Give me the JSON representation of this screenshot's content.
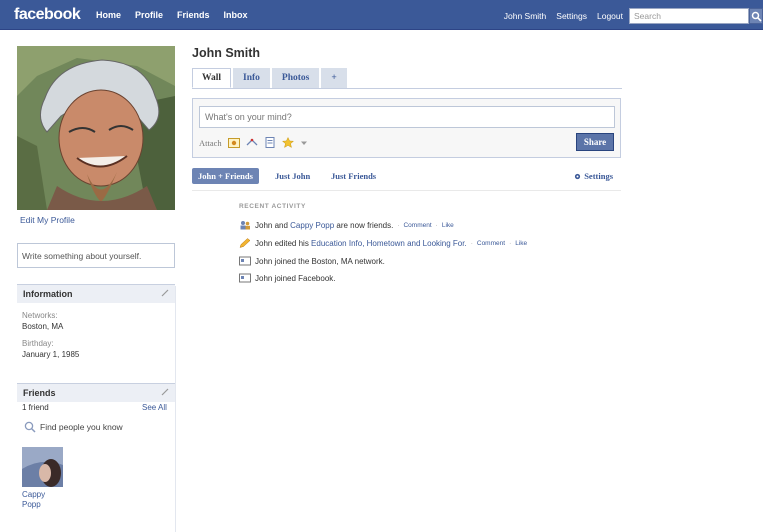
{
  "topbar": {
    "logo": "facebook",
    "nav_left": [
      "Home",
      "Profile",
      "Friends",
      "Inbox"
    ],
    "nav_right": [
      "John Smith",
      "Settings",
      "Logout"
    ],
    "search_placeholder": "Search"
  },
  "profile": {
    "name": "John Smith",
    "edit_link": "Edit My Profile",
    "about_placeholder": "Write something about yourself."
  },
  "information": {
    "title": "Information",
    "networks_label": "Networks:",
    "networks_value": "Boston, MA",
    "birthday_label": "Birthday:",
    "birthday_value": "January 1, 1985"
  },
  "friends": {
    "title": "Friends",
    "count": "1 friend",
    "see_all": "See All",
    "find_people": "Find people you know",
    "friend_name_1": "Cappy",
    "friend_name_2": "Popp"
  },
  "tabs": [
    "Wall",
    "Info",
    "Photos",
    "+"
  ],
  "publisher": {
    "placeholder": "What's on your mind?",
    "attach_label": "Attach",
    "share_label": "Share"
  },
  "filters": {
    "active": "John + Friends",
    "just_john": "Just John",
    "just_friends": "Just Friends",
    "settings": "Settings"
  },
  "recent_activity": {
    "label": "RECENT ACTIVITY",
    "items": [
      {
        "pre": "John and ",
        "link": "Cappy Popp",
        "post": " are now friends.",
        "actions": true
      },
      {
        "pre": "John edited his ",
        "link": "Education Info, Hometown and Looking For.",
        "post": "",
        "actions": true
      },
      {
        "pre": "John joined the Boston, MA network.",
        "link": "",
        "post": "",
        "actions": false
      },
      {
        "pre": "John joined Facebook.",
        "link": "",
        "post": "",
        "actions": false
      }
    ],
    "comment": "Comment",
    "like": "Like",
    "dot": "·"
  }
}
